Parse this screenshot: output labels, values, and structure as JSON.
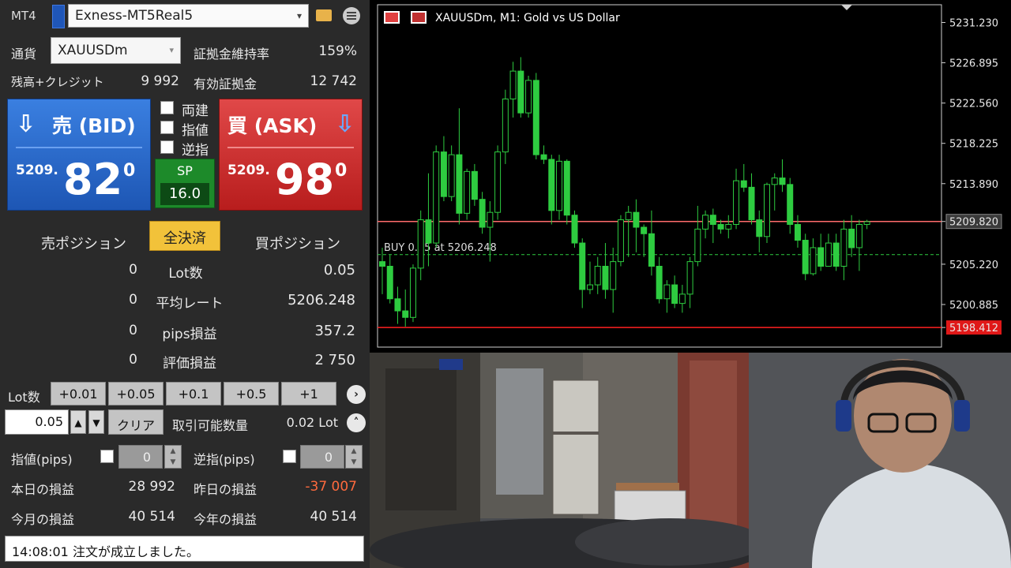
{
  "app": {
    "name": "MT4",
    "account": "Exness-MT5Real5"
  },
  "symbol": {
    "label": "通貨",
    "value": "XAUUSDm"
  },
  "margin_level": {
    "label": "証拠金維持率",
    "value": "159%"
  },
  "balance": {
    "label": "残高+クレジット",
    "value": "9 992"
  },
  "equity": {
    "label": "有効証拠金",
    "value": "12 742"
  },
  "bid": {
    "label": "売 (BID)",
    "prefix": "5209.",
    "big": "82",
    "sup": "0",
    "color": "#1d56b4"
  },
  "ask": {
    "label": "買 (ASK)",
    "prefix": "5209.",
    "big": "98",
    "sup": "0",
    "color": "#b81d1d"
  },
  "options": [
    {
      "label": "両建"
    },
    {
      "label": "指値"
    },
    {
      "label": "逆指"
    }
  ],
  "spread": {
    "label": "SP",
    "value": "16.0"
  },
  "positions": {
    "sell_header": "売ポジション",
    "close_all": "全決済",
    "buy_header": "買ポジション",
    "rows": [
      {
        "sell": "0",
        "label": "Lot数",
        "buy": "0.05"
      },
      {
        "sell": "0",
        "label": "平均レート",
        "buy": "5206.248"
      },
      {
        "sell": "0",
        "label": "pips損益",
        "buy": "357.2"
      },
      {
        "sell": "0",
        "label": "評価損益",
        "buy": "2 750"
      }
    ]
  },
  "lot": {
    "label": "Lot数",
    "buttons": [
      "+0.01",
      "+0.05",
      "+0.1",
      "+0.5",
      "+1"
    ],
    "value": "0.05",
    "clear": "クリア",
    "tradable_label": "取引可能数量",
    "tradable_value": "0.02 Lot"
  },
  "limit": {
    "label": "指値(pips)",
    "value": "0"
  },
  "stop": {
    "label": "逆指(pips)",
    "value": "0"
  },
  "pnl": {
    "today_label": "本日の損益",
    "today": "28 992",
    "yesterday_label": "昨日の損益",
    "yesterday": "-37 007",
    "month_label": "今月の損益",
    "month": "40 514",
    "year_label": "今年の損益",
    "year": "40 514",
    "negative_color": "#ff6a3d"
  },
  "status_message": "14:08:01 注文が成立しました。",
  "chart": {
    "title": "XAUUSDm, M1:  Gold vs US Dollar",
    "order_label": "BUY 0.05 at 5206.248",
    "bid_tag": "5209.820",
    "red_tag": "5198.412"
  },
  "chart_data": {
    "type": "candlestick",
    "symbol": "XAUUSDm",
    "timeframe": "M1",
    "title": "XAUUSDm, M1:  Gold vs US Dollar",
    "y_ticks": [
      5231.23,
      5226.895,
      5222.56,
      5218.225,
      5213.89,
      5209.82,
      5205.22,
      5200.885,
      5198.412
    ],
    "ylim": [
      5196.3,
      5232.8
    ],
    "horizontal_lines": [
      {
        "price": 5209.82,
        "color": "#ff6b6b",
        "style": "solid"
      },
      {
        "price": 5206.248,
        "color": "#2ecc40",
        "style": "dashed",
        "label": "BUY 0.05 at 5206.248"
      },
      {
        "price": 5198.412,
        "color": "#ff2020",
        "style": "solid"
      }
    ],
    "candles": [
      [
        5205.5,
        5207.0,
        5202.0,
        5205.0
      ],
      [
        5205.0,
        5206.2,
        5201.0,
        5201.5
      ],
      [
        5201.5,
        5202.8,
        5198.8,
        5200.2
      ],
      [
        5200.2,
        5202.5,
        5198.5,
        5199.5
      ],
      [
        5199.5,
        5205.2,
        5199.0,
        5204.8
      ],
      [
        5204.8,
        5211.0,
        5203.5,
        5210.0
      ],
      [
        5210.0,
        5215.0,
        5205.0,
        5207.5
      ],
      [
        5207.5,
        5218.0,
        5207.0,
        5217.3
      ],
      [
        5217.3,
        5219.0,
        5212.0,
        5212.5
      ],
      [
        5212.5,
        5218.0,
        5212.0,
        5217.0
      ],
      [
        5217.0,
        5222.0,
        5209.5,
        5210.7
      ],
      [
        5210.7,
        5215.5,
        5210.0,
        5215.2
      ],
      [
        5215.2,
        5216.0,
        5211.5,
        5212.2
      ],
      [
        5212.2,
        5213.0,
        5208.5,
        5209.2
      ],
      [
        5209.2,
        5212.0,
        5205.5,
        5210.8
      ],
      [
        5210.8,
        5218.0,
        5210.0,
        5217.3
      ],
      [
        5217.3,
        5224.0,
        5216.0,
        5223.0
      ],
      [
        5223.0,
        5227.0,
        5221.0,
        5226.0
      ],
      [
        5226.0,
        5227.5,
        5221.0,
        5221.5
      ],
      [
        5221.5,
        5225.5,
        5221.0,
        5225.0
      ],
      [
        5225.0,
        5225.8,
        5216.5,
        5217.0
      ],
      [
        5217.0,
        5218.0,
        5216.0,
        5216.5
      ],
      [
        5216.5,
        5217.0,
        5209.5,
        5211.0
      ],
      [
        5211.0,
        5217.0,
        5210.0,
        5216.3
      ],
      [
        5216.3,
        5216.5,
        5209.5,
        5210.5
      ],
      [
        5210.5,
        5211.0,
        5207.0,
        5207.5
      ],
      [
        5207.5,
        5208.0,
        5200.5,
        5202.5
      ],
      [
        5202.5,
        5205.5,
        5202.0,
        5203.0
      ],
      [
        5203.0,
        5206.0,
        5202.0,
        5205.0
      ],
      [
        5205.0,
        5207.5,
        5201.5,
        5202.5
      ],
      [
        5202.5,
        5207.0,
        5200.0,
        5205.5
      ],
      [
        5205.5,
        5210.5,
        5205.0,
        5210.0
      ],
      [
        5210.0,
        5211.5,
        5206.0,
        5210.8
      ],
      [
        5210.8,
        5212.2,
        5206.5,
        5209.2
      ],
      [
        5209.2,
        5209.5,
        5206.0,
        5208.5
      ],
      [
        5208.5,
        5211.0,
        5204.0,
        5205.0
      ],
      [
        5205.0,
        5206.0,
        5201.0,
        5201.5
      ],
      [
        5201.5,
        5203.5,
        5200.0,
        5203.0
      ],
      [
        5203.0,
        5204.0,
        5200.5,
        5201.0
      ],
      [
        5201.0,
        5203.0,
        5200.0,
        5202.0
      ],
      [
        5202.0,
        5206.0,
        5200.5,
        5205.5
      ],
      [
        5205.5,
        5211.5,
        5205.0,
        5209.0
      ],
      [
        5209.0,
        5211.0,
        5208.0,
        5210.5
      ],
      [
        5210.5,
        5211.2,
        5207.5,
        5209.5
      ],
      [
        5209.5,
        5210.0,
        5208.5,
        5209.0
      ],
      [
        5209.0,
        5210.5,
        5208.0,
        5209.5
      ],
      [
        5209.5,
        5215.5,
        5209.0,
        5214.2
      ],
      [
        5214.2,
        5216.0,
        5213.0,
        5213.5
      ],
      [
        5213.5,
        5215.0,
        5209.5,
        5210.0
      ],
      [
        5210.0,
        5211.0,
        5206.5,
        5208.2
      ],
      [
        5208.2,
        5214.0,
        5207.5,
        5213.8
      ],
      [
        5213.8,
        5215.0,
        5211.0,
        5214.5
      ],
      [
        5214.5,
        5216.5,
        5213.0,
        5213.8
      ],
      [
        5213.8,
        5214.5,
        5208.5,
        5209.5
      ],
      [
        5209.5,
        5210.5,
        5207.0,
        5207.8
      ],
      [
        5207.8,
        5208.5,
        5203.5,
        5204.2
      ],
      [
        5204.2,
        5208.0,
        5204.0,
        5207.0
      ],
      [
        5207.0,
        5208.5,
        5204.5,
        5205.0
      ],
      [
        5205.0,
        5208.5,
        5205.0,
        5207.5
      ],
      [
        5207.5,
        5208.5,
        5204.5,
        5205.0
      ],
      [
        5205.0,
        5210.0,
        5203.5,
        5209.0
      ],
      [
        5209.0,
        5210.5,
        5206.0,
        5207.0
      ],
      [
        5207.0,
        5210.0,
        5204.5,
        5209.5
      ],
      [
        5209.5,
        5210.0,
        5209.0,
        5209.8
      ]
    ]
  },
  "colors": {
    "panel_bg": "#2a2a2a",
    "bull": "#2ecc40",
    "spread_green": "#1d8a2a",
    "close_all_yellow": "#f2c23a"
  }
}
